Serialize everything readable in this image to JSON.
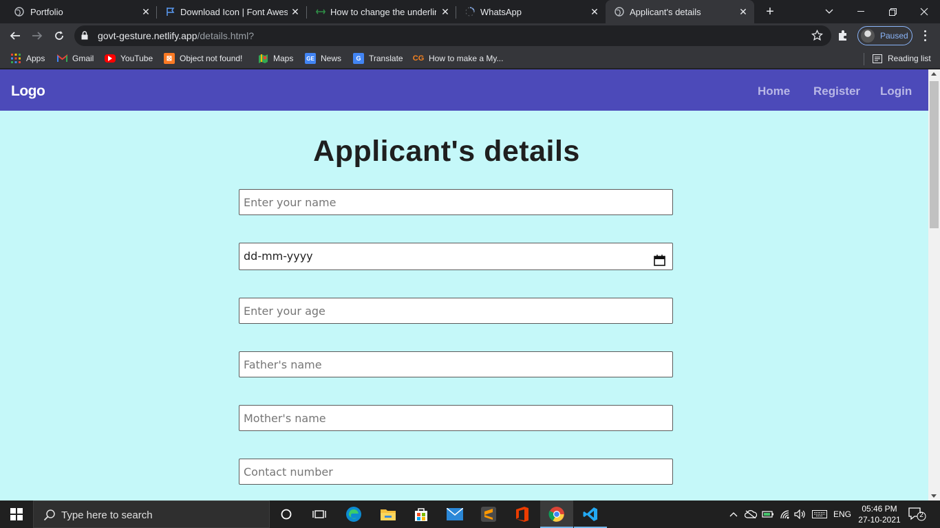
{
  "browser": {
    "tabs": [
      {
        "title": "Portfolio"
      },
      {
        "title": "Download Icon | Font Awesome"
      },
      {
        "title": "How to change the underline"
      },
      {
        "title": "WhatsApp"
      },
      {
        "title": "Applicant's details"
      }
    ],
    "url_host": "govt-gesture.netlify.app",
    "url_path": "/details.html?",
    "profile_label": "Paused",
    "bookmarks": [
      {
        "label": "Apps"
      },
      {
        "label": "Gmail"
      },
      {
        "label": "YouTube"
      },
      {
        "label": "Object not found!"
      },
      {
        "label": "Maps"
      },
      {
        "label": "News"
      },
      {
        "label": "Translate"
      },
      {
        "label": "How to make a My..."
      }
    ],
    "reading_list": "Reading list"
  },
  "site": {
    "logo": "Logo",
    "nav": [
      {
        "label": "Home"
      },
      {
        "label": "Register"
      },
      {
        "label": "Login"
      }
    ],
    "title": "Applicant's details",
    "form": {
      "name_placeholder": "Enter your name",
      "dob_placeholder": "dd-mm-yyyy",
      "age_placeholder": "Enter your age",
      "father_placeholder": "Father's name",
      "mother_placeholder": "Mother's name",
      "contact_placeholder": "Contact number"
    },
    "colors": {
      "navbar": "#4c4ab9",
      "background": "#c5f8f9"
    }
  },
  "taskbar": {
    "search_placeholder": "Type here to search",
    "language": "ENG",
    "time": "05:46 PM",
    "date": "27-10-2021",
    "notifications": "2"
  }
}
